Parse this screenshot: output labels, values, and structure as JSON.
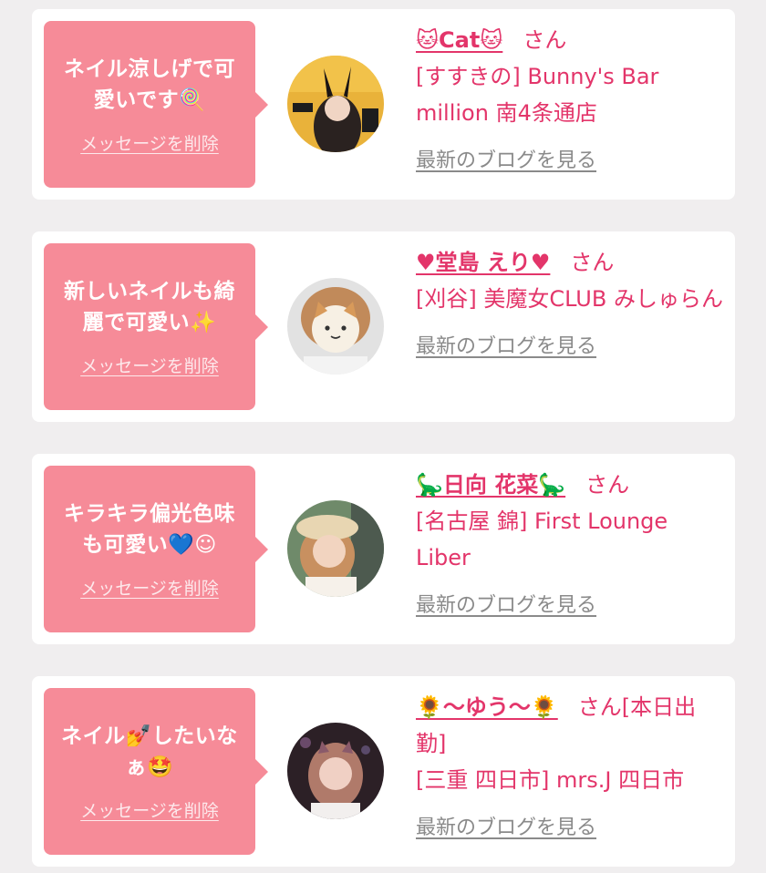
{
  "messages": [
    {
      "text": "ネイル涼しげで可愛いです🍭",
      "delete_label": "メッセージを削除",
      "name": "🐱Cat🐱",
      "honorific": "さん",
      "shop": "[すすきの] Bunny's Bar million 南4条通店",
      "blog_link": "最新のブログを見る"
    },
    {
      "text": "新しいネイルも綺麗で可愛い✨",
      "delete_label": "メッセージを削除",
      "name": "♥堂島 えり♥",
      "honorific": "さん",
      "shop": "[刈谷] 美魔女CLUB みしゅらん",
      "blog_link": "最新のブログを見る"
    },
    {
      "text": "キラキラ偏光色味も可愛い💙☺",
      "delete_label": "メッセージを削除",
      "name": "🦕日向 花菜🦕",
      "honorific": "さん",
      "shop": "[名古屋 錦] First Lounge Liber",
      "blog_link": "最新のブログを見る"
    },
    {
      "text": "ネイル💅したいなぁ🤩",
      "delete_label": "メッセージを削除",
      "name": "🌻〜ゆう〜🌻",
      "honorific": "さん[本日出勤]",
      "shop": "[三重 四日市] mrs.J 四日市",
      "blog_link": "最新のブログを見る"
    }
  ],
  "colors": {
    "page_bg": "#f0eeef",
    "bubble": "#f68b98",
    "accent_text": "#e3356a",
    "link_gray": "#8a8a8a"
  }
}
